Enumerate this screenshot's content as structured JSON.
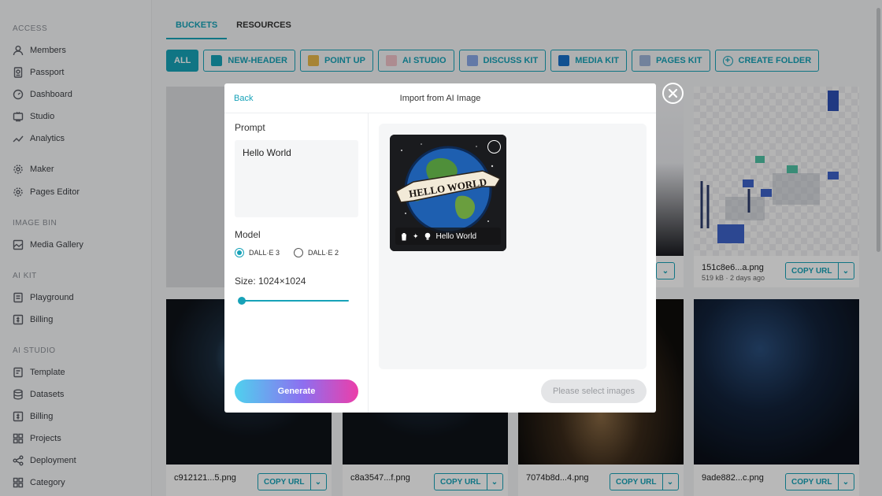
{
  "sidebar": {
    "sections": [
      {
        "title": "ACCESS",
        "items": [
          {
            "label": "Members",
            "icon": "user-icon"
          },
          {
            "label": "Passport",
            "icon": "passport-icon"
          },
          {
            "label": "Dashboard",
            "icon": "dashboard-icon"
          },
          {
            "label": "Studio",
            "icon": "studio-icon"
          },
          {
            "label": "Analytics",
            "icon": "analytics-icon"
          },
          {
            "label": "Maker",
            "icon": "gear-icon"
          },
          {
            "label": "Pages Editor",
            "icon": "gear-icon"
          }
        ]
      },
      {
        "title": "IMAGE BIN",
        "items": [
          {
            "label": "Media Gallery",
            "icon": "gallery-icon"
          }
        ]
      },
      {
        "title": "AI KIT",
        "items": [
          {
            "label": "Playground",
            "icon": "playground-icon"
          },
          {
            "label": "Billing",
            "icon": "billing-icon"
          }
        ]
      },
      {
        "title": "AI STUDIO",
        "items": [
          {
            "label": "Template",
            "icon": "template-icon"
          },
          {
            "label": "Datasets",
            "icon": "database-icon"
          },
          {
            "label": "Billing",
            "icon": "billing-icon"
          },
          {
            "label": "Projects",
            "icon": "grid-icon"
          },
          {
            "label": "Deployment",
            "icon": "share-icon"
          },
          {
            "label": "Category",
            "icon": "grid-icon"
          }
        ]
      }
    ]
  },
  "tabs": [
    {
      "label": "BUCKETS",
      "active": true
    },
    {
      "label": "RESOURCES",
      "active": false
    }
  ],
  "filters": [
    "ALL",
    "NEW-HEADER",
    "POINT UP",
    "AI STUDIO",
    "DISCUSS KIT",
    "MEDIA KIT",
    "PAGES KIT",
    "CREATE FOLDER"
  ],
  "cards": {
    "top_right": {
      "name": "151c8e6...a.png",
      "meta": "519 kB · 2 days ago",
      "copy_label": "COPY URL"
    },
    "bottom": [
      {
        "name": "c912121...5.png",
        "copy_label": "COPY URL"
      },
      {
        "name": "c8a3547...f.png",
        "copy_label": "COPY URL"
      },
      {
        "name": "7074b8d...4.png",
        "copy_label": "COPY URL"
      },
      {
        "name": "9ade882...c.png",
        "copy_label": "COPY URL"
      }
    ]
  },
  "modal": {
    "back_label": "Back",
    "title": "Import from AI Image",
    "prompt_label": "Prompt",
    "prompt_value": "Hello World",
    "model_label": "Model",
    "models": [
      {
        "label": "DALL·E 3",
        "selected": true
      },
      {
        "label": "DALL·E 2",
        "selected": false
      }
    ],
    "size_label": "Size: 1024×1024",
    "generate_label": "Generate",
    "image": {
      "caption": "Hello World",
      "banner_text": "HELLO WORLD"
    },
    "select_label": "Please select images"
  },
  "colors": {
    "accent": "#17a2b8",
    "overlay": "rgba(0,0,0,0.28)"
  }
}
